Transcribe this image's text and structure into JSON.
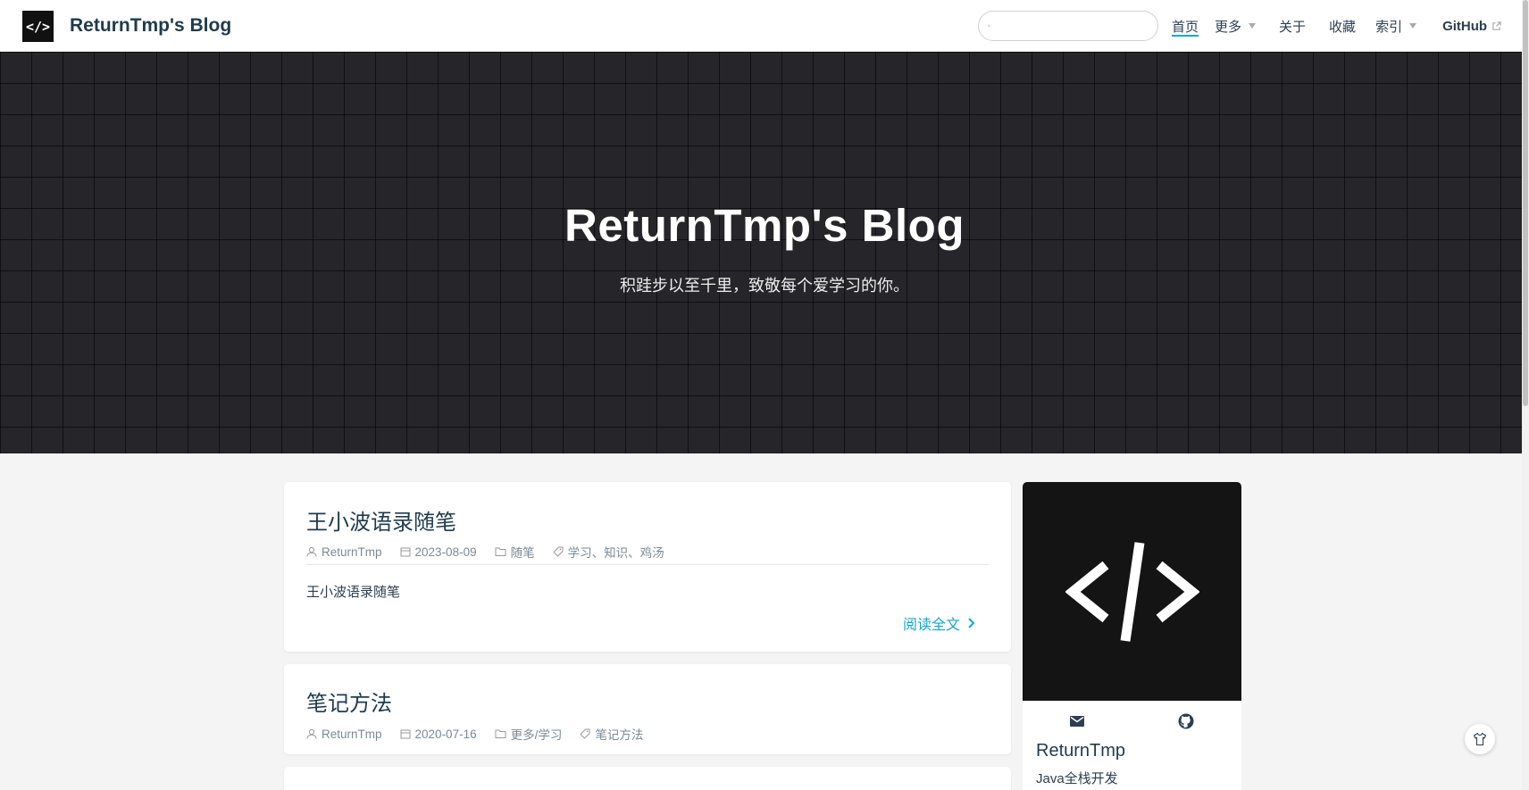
{
  "header": {
    "logo_text": "</>",
    "site_name": "ReturnTmp's Blog",
    "search": {
      "value": "",
      "placeholder": ""
    },
    "nav": [
      {
        "label": "首页",
        "active": true,
        "dropdown": false,
        "external": false
      },
      {
        "label": "更多",
        "active": false,
        "dropdown": true,
        "external": false
      },
      {
        "label": "关于",
        "active": false,
        "dropdown": false,
        "external": false
      },
      {
        "label": "收藏",
        "active": false,
        "dropdown": false,
        "external": false
      },
      {
        "label": "索引",
        "active": false,
        "dropdown": true,
        "external": false
      },
      {
        "label": "GitHub",
        "active": false,
        "dropdown": false,
        "external": true
      }
    ]
  },
  "hero": {
    "title": "ReturnTmp's Blog",
    "description": "积跬步以至千里，致敬每个爱学习的你。"
  },
  "posts": [
    {
      "title": "王小波语录随笔",
      "author": "ReturnTmp",
      "date": "2023-08-09",
      "category": "随笔",
      "tags": "学习、知识、鸡汤",
      "excerpt": "王小波语录随笔",
      "read_more": "阅读全文"
    },
    {
      "title": "笔记方法",
      "author": "ReturnTmp",
      "date": "2020-07-16",
      "category": "更多/学习",
      "tags": "笔记方法"
    }
  ],
  "sidebar": {
    "name": "ReturnTmp",
    "description": "Java全栈开发",
    "icons": [
      "mail-icon",
      "github-icon"
    ]
  },
  "colors": {
    "accent": "#11a8cd",
    "hero_bg": "#25252a",
    "text": "#2c3e50"
  }
}
